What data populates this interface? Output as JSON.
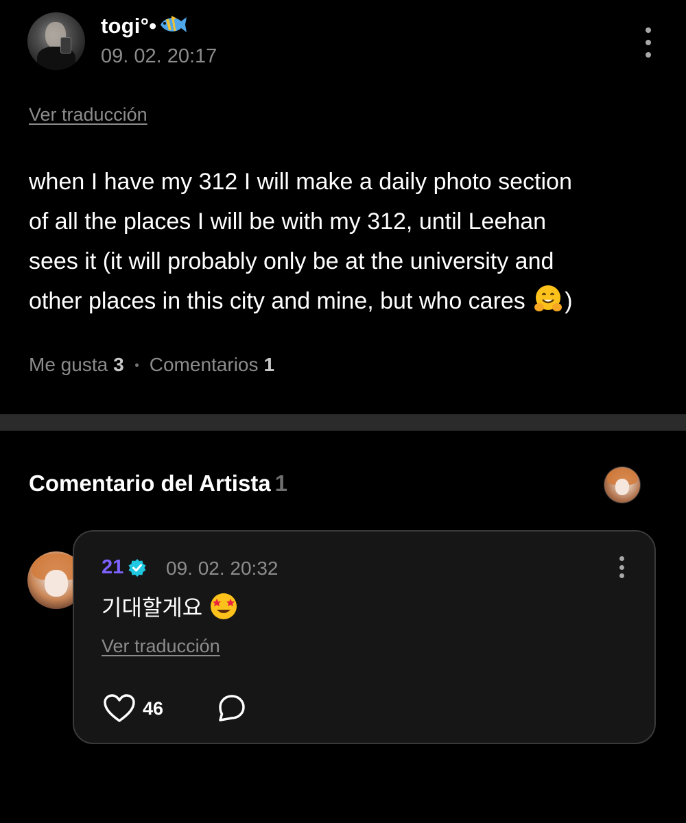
{
  "post": {
    "username": "togi°•",
    "timestamp": "09. 02. 20:17",
    "translate_label": "Ver traducción",
    "body_lines": [
      "when I have my 312 I will make a daily photo section",
      "of all the places I will be with my 312, until Leehan",
      "sees it (it will probably only be at the university and",
      "other places in this city and mine, but who cares",
      ")"
    ],
    "stats": {
      "likes_label": "Me gusta",
      "likes_count": "3",
      "comments_label": "Comentarios",
      "comments_count": "1"
    }
  },
  "artist_section": {
    "title": "Comentario del Artista",
    "count": "1"
  },
  "comment": {
    "author": "21",
    "timestamp": "09. 02. 20:32",
    "text": "기대할게요",
    "translate_label": "Ver traducción",
    "like_count": "46"
  },
  "colors": {
    "background": "#000000",
    "muted_text": "#8c8c8c",
    "artist_name": "#7d62ff",
    "verified_badge": "#1fc7e0",
    "card_background": "#161616",
    "separator": "#2b2b2b"
  },
  "icons": {
    "post_kebab": "more-vertical-icon",
    "fish": "tropical-fish-icon",
    "hug_emoji": "hugging-face-emoji",
    "verified": "verified-badge-icon",
    "heart_eyes": "star-struck-emoji",
    "like": "heart-outline-icon",
    "reply": "comment-bubble-icon"
  }
}
